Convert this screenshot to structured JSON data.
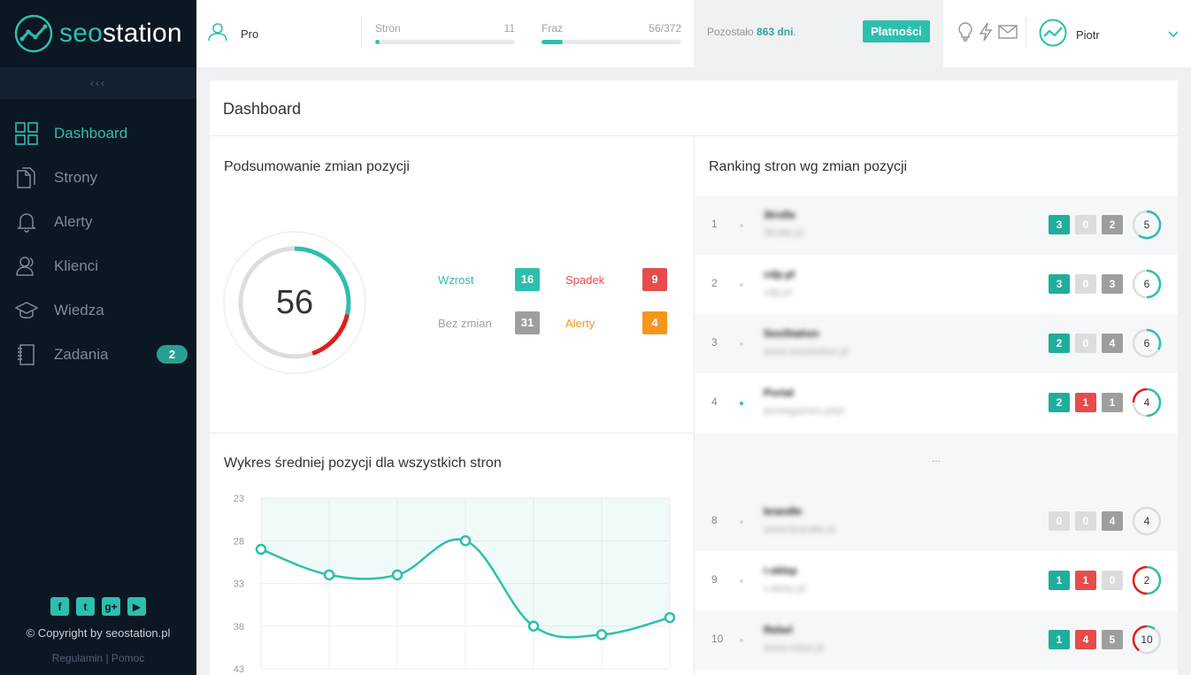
{
  "brand": {
    "name_part1": "seo",
    "name_part2": "station"
  },
  "sidebar": {
    "collapse_label": "‹‹‹",
    "items": [
      {
        "label": "Dashboard",
        "icon": "grid-icon",
        "active": true
      },
      {
        "label": "Strony",
        "icon": "pages-icon",
        "active": false
      },
      {
        "label": "Alerty",
        "icon": "bell-icon",
        "active": false
      },
      {
        "label": "Klienci",
        "icon": "users-icon",
        "active": false
      },
      {
        "label": "Wiedza",
        "icon": "graduation-cap-icon",
        "active": false
      },
      {
        "label": "Zadania",
        "icon": "notebook-icon",
        "active": false,
        "badge": "2"
      }
    ],
    "socials": [
      "f",
      "t",
      "g+",
      "▶"
    ],
    "copyright": "© Copyright by seostation.pl",
    "links": {
      "terms": "Regulamin",
      "sep": "|",
      "help": "Pomoc"
    }
  },
  "topbar": {
    "plan": "Pro",
    "quota_pages": {
      "label": "Stron",
      "value": "11",
      "fill": 0.03
    },
    "quota_phrases": {
      "label": "Fraz",
      "value": "56/372",
      "fill": 0.15
    },
    "remaining_prefix": "Pozostało",
    "remaining_value": "863 dni",
    "remaining_suffix": ".",
    "payments_button": "Płatności",
    "user_name": "Piotr"
  },
  "dashboard": {
    "title": "Dashboard",
    "summary": {
      "title": "Podsumowanie zmian pozycji",
      "total": "56",
      "gauge": {
        "up_fraction": 0.2857,
        "down_fraction": 0.1607
      },
      "stats": [
        {
          "label": "Wzrost",
          "value": "16",
          "color": "#2dbfae",
          "label_color": "#2dbfae"
        },
        {
          "label": "Spadek",
          "value": "9",
          "color": "#e64c4c",
          "label_color": "#e64c4c"
        },
        {
          "label": "Bez zmian",
          "value": "31",
          "color": "#9e9e9e",
          "label_color": "#9aa2aa"
        },
        {
          "label": "Alerty",
          "value": "4",
          "color": "#f5951e",
          "label_color": "#f5951e"
        }
      ]
    },
    "chart_title": "Wykres średniej pozycji dla wszystkich stron",
    "chart_data": {
      "type": "area",
      "y_ticks": [
        "23",
        "28",
        "33",
        "38",
        "43"
      ],
      "ylim": [
        23,
        43
      ],
      "y_reversed": true,
      "x": [
        1,
        2,
        3,
        4,
        5,
        6,
        7
      ],
      "values": [
        29,
        32,
        32,
        28,
        38,
        39,
        37
      ],
      "color": "#2dbfae",
      "grid": true
    },
    "ranking": {
      "title": "Ranking stron wg zmian pozycji",
      "ellipsis": "...",
      "rows": [
        {
          "rank": "1",
          "name": "3trolle",
          "url": "3trolle.pl",
          "dot": false,
          "up": "3",
          "down": "0",
          "same": "2",
          "total": "5",
          "up_frac": 0.6,
          "down_frac": 0.0
        },
        {
          "rank": "2",
          "name": "cdp.pl",
          "url": "cdp.pl",
          "dot": false,
          "up": "3",
          "down": "0",
          "same": "3",
          "total": "6",
          "up_frac": 0.5,
          "down_frac": 0.0
        },
        {
          "rank": "3",
          "name": "SeoStation",
          "url": "www.seostation.pl",
          "dot": false,
          "up": "2",
          "down": "0",
          "same": "4",
          "total": "6",
          "up_frac": 0.33,
          "down_frac": 0.0
        },
        {
          "rank": "4",
          "name": "Portal",
          "url": "portalgames.pl/pl",
          "dot": true,
          "up": "2",
          "down": "1",
          "same": "1",
          "total": "4",
          "up_frac": 0.5,
          "down_frac": 0.25
        },
        {
          "rank": "8",
          "name": "brandle",
          "url": "www.brandle.pl",
          "dot": false,
          "up": "0",
          "down": "0",
          "same": "4",
          "total": "4",
          "up_frac": 0.0,
          "down_frac": 0.0
        },
        {
          "rank": "9",
          "name": "i-sklep",
          "url": "i-sklep.pl",
          "dot": false,
          "up": "1",
          "down": "1",
          "same": "0",
          "total": "2",
          "up_frac": 0.5,
          "down_frac": 0.5
        },
        {
          "rank": "10",
          "name": "Rebel",
          "url": "www.rebel.pl",
          "dot": false,
          "up": "1",
          "down": "4",
          "same": "5",
          "total": "10",
          "up_frac": 0.1,
          "down_frac": 0.4
        }
      ]
    }
  }
}
